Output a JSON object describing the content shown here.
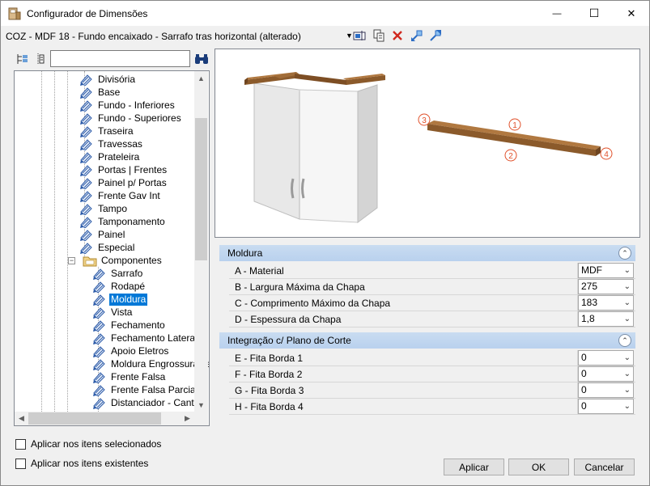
{
  "window": {
    "title": "Configurador de Dimensões",
    "minimize_glyph": "—",
    "maximize_glyph": "☐",
    "close_glyph": "✕"
  },
  "config": {
    "name": "COZ - MDF 18 - Fundo encaixado - Sarrafo tras horizontal (alterado)"
  },
  "tree": {
    "search_value": "",
    "items": [
      {
        "label": "Divisória"
      },
      {
        "label": "Base"
      },
      {
        "label": "Fundo - Inferiores"
      },
      {
        "label": "Fundo - Superiores"
      },
      {
        "label": "Traseira"
      },
      {
        "label": "Travessas"
      },
      {
        "label": "Prateleira"
      },
      {
        "label": "Portas | Frentes"
      },
      {
        "label": "Painel p/ Portas"
      },
      {
        "label": "Frente Gav Int"
      },
      {
        "label": "Tampo"
      },
      {
        "label": "Tamponamento"
      },
      {
        "label": "Painel"
      },
      {
        "label": "Especial"
      },
      {
        "label": "Componentes"
      },
      {
        "label": "Sarrafo"
      },
      {
        "label": "Rodapé"
      },
      {
        "label": "Moldura"
      },
      {
        "label": "Vista"
      },
      {
        "label": "Fechamento"
      },
      {
        "label": "Fechamento Lateral"
      },
      {
        "label": "Apoio Eletros"
      },
      {
        "label": "Moldura Engrossuramento"
      },
      {
        "label": "Frente Falsa"
      },
      {
        "label": "Frente Falsa Parcial"
      },
      {
        "label": "Distanciador - Canto"
      }
    ],
    "selected_label": "Moldura"
  },
  "preview": {
    "markers": [
      "1",
      "2",
      "3",
      "4"
    ],
    "colors": {
      "wood": "#8b5a2b",
      "marker": "#e0502a"
    }
  },
  "properties": {
    "groups": [
      {
        "title": "Moldura",
        "rows": [
          {
            "name": "A - Material",
            "value": "MDF"
          },
          {
            "name": "B - Largura Máxima da Chapa",
            "value": "275"
          },
          {
            "name": "C - Comprimento Máximo da Chapa",
            "value": "183"
          },
          {
            "name": "D - Espessura da Chapa",
            "value": "1,8"
          }
        ]
      },
      {
        "title": "Integração c/ Plano de Corte",
        "rows": [
          {
            "name": "E - Fita Borda 1",
            "value": "0"
          },
          {
            "name": "F - Fita Borda 2",
            "value": "0"
          },
          {
            "name": "G - Fita Borda 3",
            "value": "0"
          },
          {
            "name": "H - Fita Borda 4",
            "value": "0"
          }
        ]
      }
    ]
  },
  "options": {
    "apply_selected": "Aplicar nos itens selecionados",
    "apply_existing": "Aplicar nos itens existentes"
  },
  "buttons": {
    "apply": "Aplicar",
    "ok": "OK",
    "cancel": "Cancelar"
  }
}
